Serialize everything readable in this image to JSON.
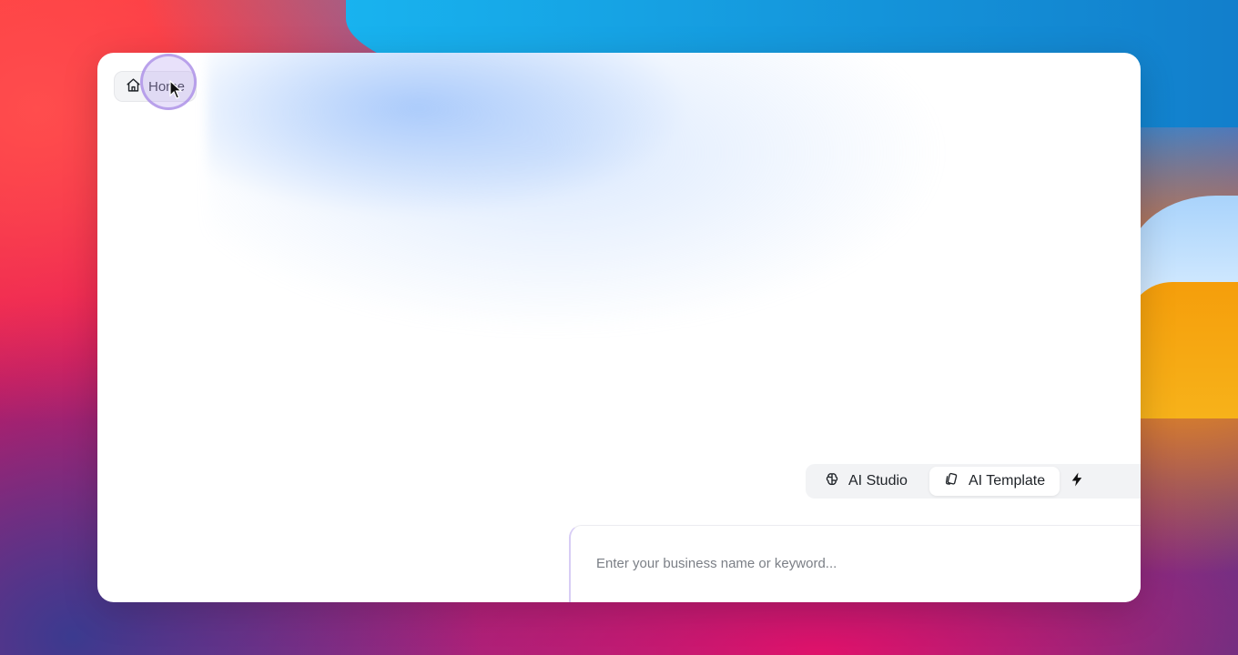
{
  "home_button": {
    "label": "Home",
    "icon": "home-icon"
  },
  "mode_tabs": [
    {
      "label": "AI Studio",
      "icon": "brain-icon",
      "active": false
    },
    {
      "label": "AI Template",
      "icon": "template-cards-icon",
      "active": true
    },
    {
      "label": "",
      "icon": "bolt-icon",
      "active": false
    }
  ],
  "prompt": {
    "value": "",
    "placeholder": "Enter your business name or keyword..."
  },
  "colors": {
    "window_bg": "#ffffff",
    "cursor_highlight": "#b9a6ee",
    "tab_bar_bg": "#f2f3f5"
  }
}
